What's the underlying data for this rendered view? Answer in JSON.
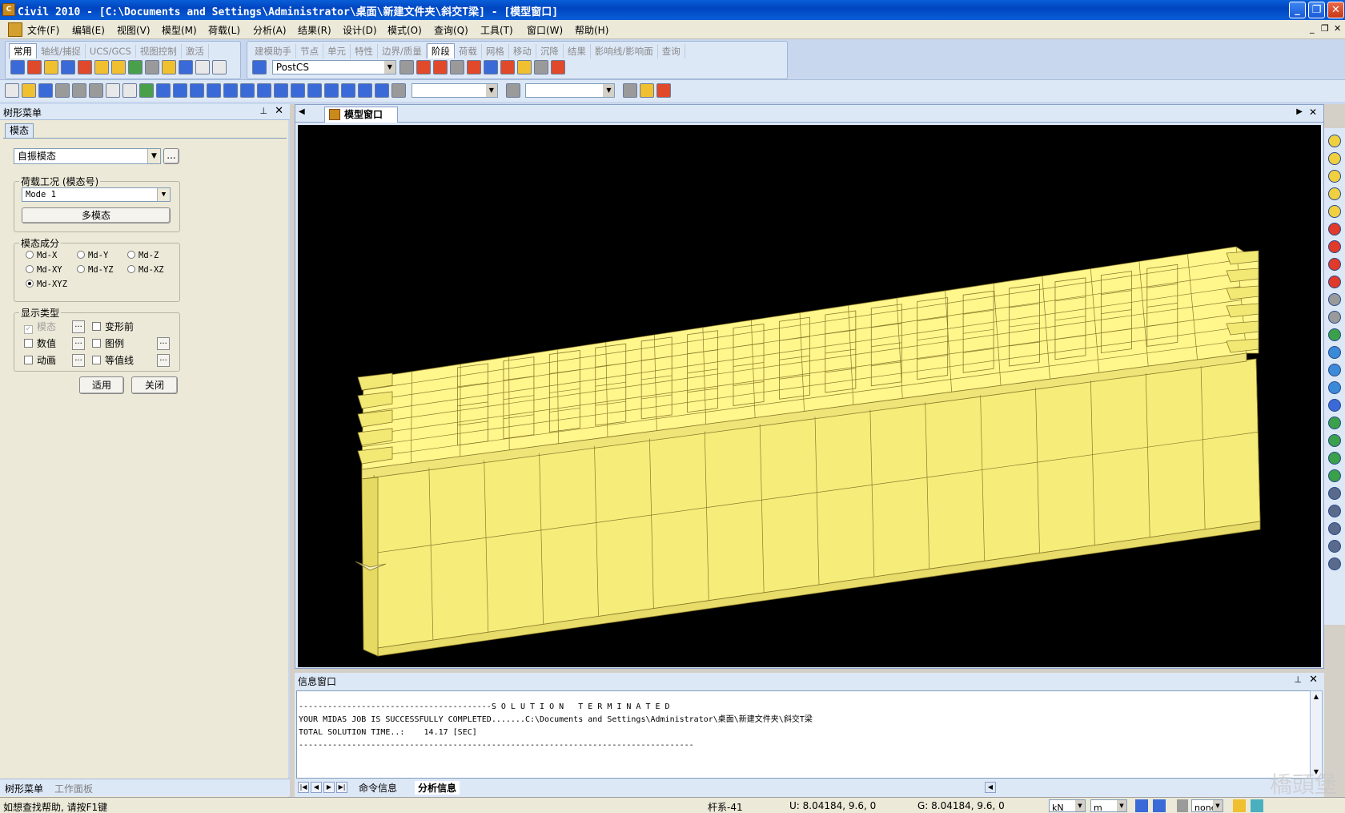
{
  "window": {
    "title": "Civil 2010 - [C:\\Documents and Settings\\Administrator\\桌面\\新建文件夹\\斜交T梁] - [模型窗口]",
    "icon": "midas-civil-icon",
    "minimize": "_",
    "restore": "❐",
    "close": "✕"
  },
  "menu": {
    "items": [
      "文件(F)",
      "编辑(E)",
      "视图(V)",
      "模型(M)",
      "荷载(L)",
      "分析(A)",
      "结果(R)",
      "设计(D)",
      "模式(O)",
      "查询(Q)",
      "工具(T)",
      "窗口(W)",
      "帮助(H)"
    ],
    "mdi_min": "_",
    "mdi_restore": "❐",
    "mdi_close": "✕"
  },
  "ribbon": {
    "tabs_left": [
      "常用",
      "轴线/捕捉",
      "UCS/GCS",
      "视图控制",
      "激活"
    ],
    "tabs_right": [
      "建模助手",
      "节点",
      "单元",
      "特性",
      "边界/质量",
      "阶段",
      "荷载",
      "网格",
      "移动",
      "沉降",
      "结果",
      "影响线/影响面",
      "查询"
    ],
    "active_left": "常用",
    "active_right": "阶段",
    "stage_select": "PostCS"
  },
  "left_panel": {
    "title": "树形菜单",
    "pin": "⊥",
    "close": "✕",
    "tab": "模态",
    "mode_type": "自振模态",
    "browse": "...",
    "load_group_label": "荷载工况 (模态号)",
    "mode_select": "Mode 1",
    "multi_mode_button": "多模态",
    "component_group_label": "模态成分",
    "components": [
      "Md-X",
      "Md-Y",
      "Md-Z",
      "Md-XY",
      "Md-YZ",
      "Md-XZ",
      "Md-XYZ"
    ],
    "component_selected": "Md-XYZ",
    "display_group_label": "显示类型",
    "display": {
      "mode": "模态",
      "before_deform": "变形前",
      "value": "数值",
      "legend": "图例",
      "animation": "动画",
      "contour": "等值线"
    },
    "apply_button": "适用",
    "close_button": "关闭",
    "bottom_tabs": [
      "树形菜单",
      "工作面板"
    ]
  },
  "model_window": {
    "tab_label": "模型窗口",
    "background": "#000000",
    "beam_color": "#fff68c",
    "edge_color": "#8a7a2a"
  },
  "info_window": {
    "title": "信息窗口",
    "lines": [
      "----------------------------------------S O L U T I O N   T E R M I N A T E D",
      "YOUR MIDAS JOB IS SUCCESSFULLY COMPLETED.......C:\\Documents and Settings\\Administrator\\桌面\\新建文件夹\\斜交T梁",
      "TOTAL SOLUTION TIME..:    14.17 [SEC]",
      "----------------------------------------------------------------------------------"
    ],
    "tabs": [
      "命令信息",
      "分析信息"
    ],
    "active_tab": "分析信息"
  },
  "status": {
    "help": "如想查找帮助, 请按F1键",
    "element": "杆系-41",
    "ucs": "U: 8.04184, 9.6, 0",
    "gcs": "G: 8.04184, 9.6, 0",
    "force_unit": "kN",
    "length_unit": "m",
    "snap": "none"
  },
  "watermark": "橋頭堡"
}
